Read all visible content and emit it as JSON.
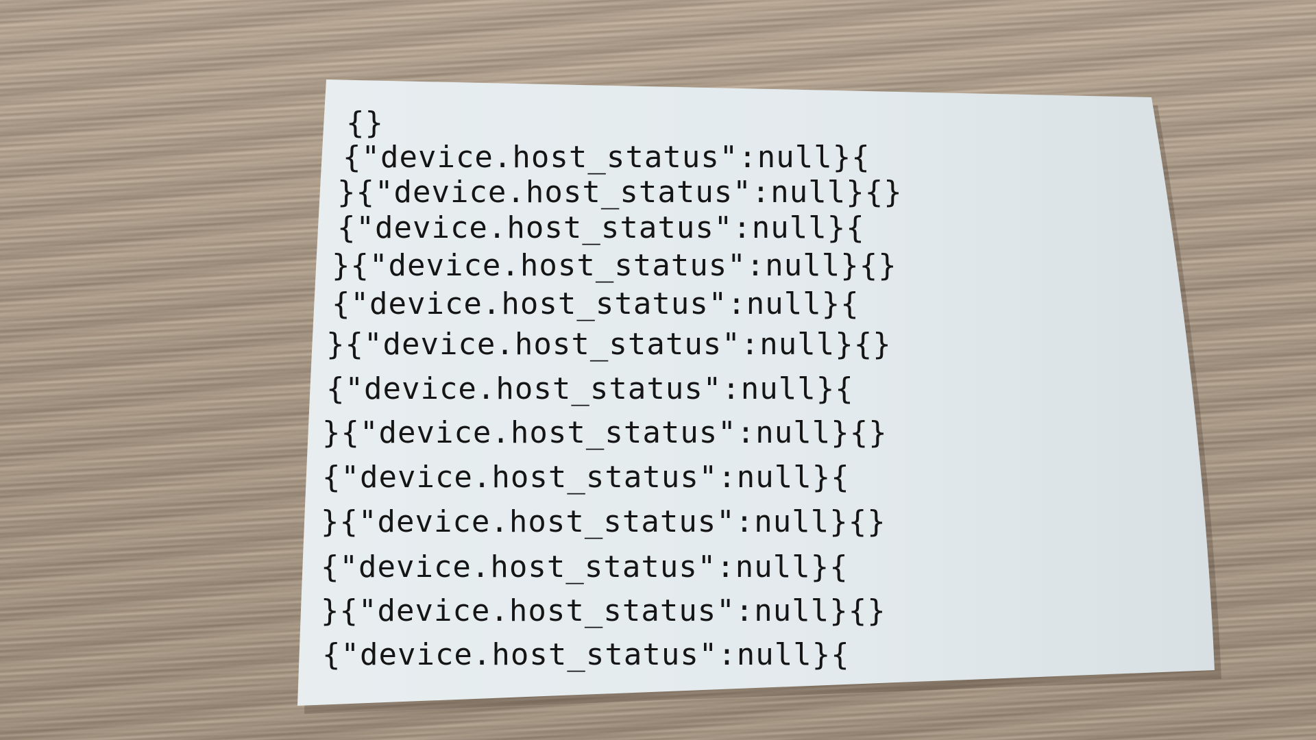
{
  "colors": {
    "paper": "#e4ebee",
    "paper_edge": "#d6dde0",
    "ink": "#151515",
    "wood": "#b3a38f"
  },
  "receipt": {
    "lines": [
      "{}",
      "{\"device.host_status\":null}{",
      "}{\"device.host_status\":null}{}",
      "{\"device.host_status\":null}{",
      "}{\"device.host_status\":null}{}",
      "{\"device.host_status\":null}{",
      "}{\"device.host_status\":null}{}",
      "{\"device.host_status\":null}{",
      "}{\"device.host_status\":null}{}",
      "{\"device.host_status\":null}{",
      "}{\"device.host_status\":null}{}",
      "{\"device.host_status\":null}{",
      "}{\"device.host_status\":null}{}",
      "{\"device.host_status\":null}{"
    ]
  }
}
